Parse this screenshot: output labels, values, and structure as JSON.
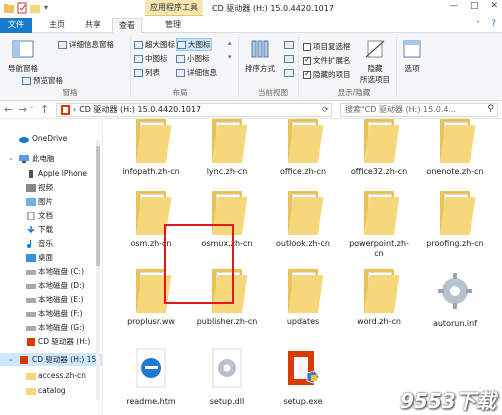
{
  "window": {
    "context_tab": "应用程序工具",
    "title": "CD 驱动器 (H:) 15.0.4420.1017",
    "controls": [
      "—",
      "□",
      "✕"
    ]
  },
  "tabs": [
    "文件",
    "主页",
    "共享",
    "查看",
    "管理"
  ],
  "ribbon": {
    "pane_group": {
      "nav_pane": "导航窗格",
      "preview_pane": "预览窗格",
      "details_pane": "详细信息窗格",
      "label": "窗格"
    },
    "layout_group": {
      "items": [
        "超大图标",
        "大图标",
        "中图标",
        "小图标",
        "列表",
        "详细信息"
      ],
      "selected": "大图标",
      "label": "布局"
    },
    "current_view_group": {
      "sort": "排序方式",
      "label": "当前视图"
    },
    "show_hide_group": {
      "checkboxes": [
        {
          "label": "项目复选框",
          "checked": false
        },
        {
          "label": "文件扩展名",
          "checked": true
        },
        {
          "label": "隐藏的项目",
          "checked": true
        }
      ],
      "hide_button": "隐藏",
      "hide_sub": "所选项目",
      "label": "显示/隐藏"
    },
    "options": "选项"
  },
  "address": {
    "path": "CD 驱动器 (H:) 15.0.4420.1017",
    "search_placeholder": "搜索\"CD 驱动器 (H:) 15.0.4...",
    "chevron": "›"
  },
  "sidebar": {
    "items": [
      {
        "label": "OneDrive",
        "icon": "cloud-icon"
      },
      {
        "label": "此电脑",
        "icon": "computer-icon"
      },
      {
        "label": "Apple iPhone",
        "icon": "phone-icon"
      },
      {
        "label": "视频",
        "icon": "video-icon"
      },
      {
        "label": "图片",
        "icon": "picture-icon"
      },
      {
        "label": "文档",
        "icon": "document-icon"
      },
      {
        "label": "下载",
        "icon": "download-icon"
      },
      {
        "label": "音乐",
        "icon": "music-icon"
      },
      {
        "label": "桌面",
        "icon": "desktop-icon"
      },
      {
        "label": "本地磁盘 (C:)",
        "icon": "disk-icon"
      },
      {
        "label": "本地磁盘 (D:)",
        "icon": "disk-icon"
      },
      {
        "label": "本地磁盘 (E:)",
        "icon": "disk-icon"
      },
      {
        "label": "本地磁盘 (F:)",
        "icon": "disk-icon"
      },
      {
        "label": "本地磁盘 (G:)",
        "icon": "disk-icon"
      },
      {
        "label": "CD 驱动器 (H:)",
        "icon": "office-icon"
      },
      {
        "label": "CD 驱动器 (H:) 15",
        "icon": "office-icon",
        "selected": true
      },
      {
        "label": "access.zh-cn",
        "icon": "folder-icon"
      },
      {
        "label": "catalog",
        "icon": "folder-icon"
      }
    ]
  },
  "files": [
    {
      "name": "infopath.zh-cn",
      "type": "folder"
    },
    {
      "name": "lync.zh-cn",
      "type": "folder"
    },
    {
      "name": "office.zh-cn",
      "type": "folder"
    },
    {
      "name": "office32.zh-cn",
      "type": "folder"
    },
    {
      "name": "onenote.zh-cn",
      "type": "folder"
    },
    {
      "name": "osm.zh-cn",
      "type": "folder"
    },
    {
      "name": "osmux.zh-cn",
      "type": "folder"
    },
    {
      "name": "outlook.zh-cn",
      "type": "folder"
    },
    {
      "name": "powerpoint.zh-cn",
      "type": "folder"
    },
    {
      "name": "proofing.zh-cn",
      "type": "folder"
    },
    {
      "name": "proplusr.ww",
      "type": "folder"
    },
    {
      "name": "publisher.zh-cn",
      "type": "folder"
    },
    {
      "name": "updates",
      "type": "folder"
    },
    {
      "name": "word.zh-cn",
      "type": "folder"
    },
    {
      "name": "autorun.inf",
      "type": "settings"
    },
    {
      "name": "readme.htm",
      "type": "edge"
    },
    {
      "name": "setup.dll",
      "type": "gear"
    },
    {
      "name": "setup.exe",
      "type": "office",
      "selected": true
    }
  ],
  "watermark": "9553下载",
  "colors": {
    "accent": "#1979ca",
    "folder": "#f7d77b",
    "selection_border": "#e0191f",
    "office_orange": "#d83b01"
  }
}
